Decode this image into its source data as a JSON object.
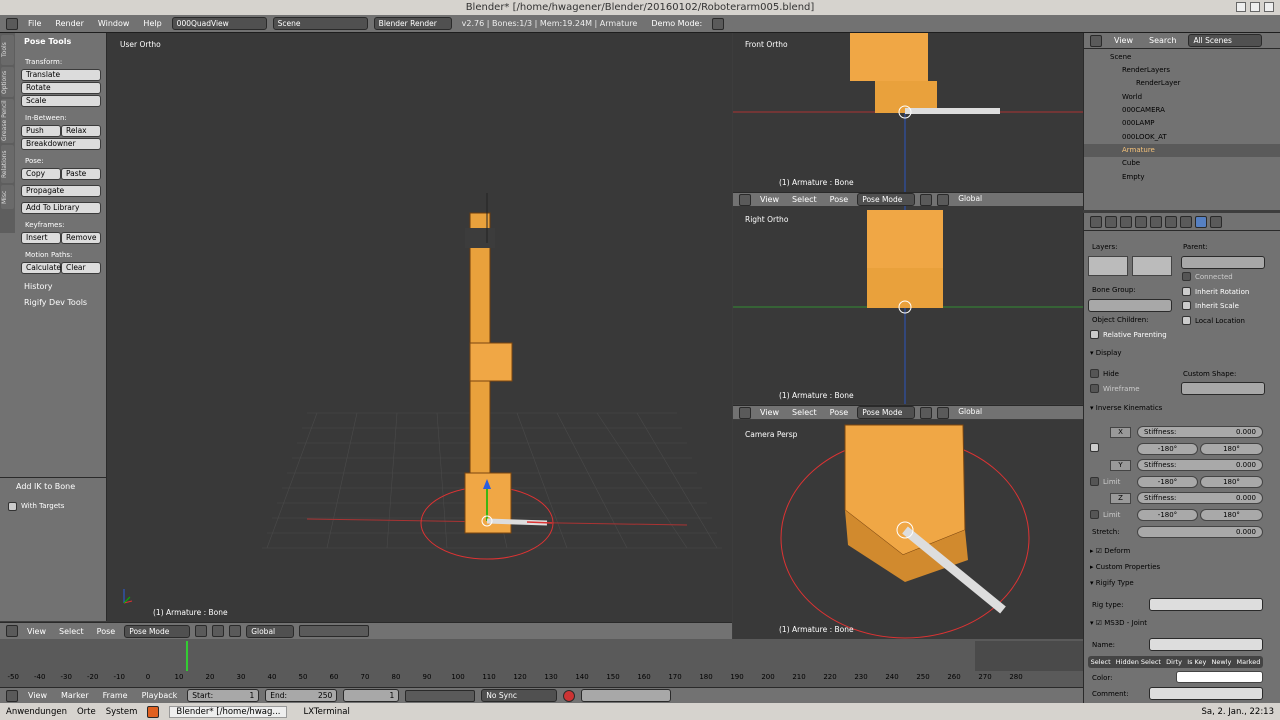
{
  "window": {
    "title": "Blender* [/home/hwagener/Blender/20160102/Roboterarm005.blend]"
  },
  "menubar": {
    "file": "File",
    "render": "Render",
    "window": "Window",
    "help": "Help",
    "screen_layout": "000QuadView",
    "scene": "Scene",
    "engine": "Blender Render",
    "stats": "v2.76 | Bones:1/3 | Mem:19.24M | Armature",
    "demo_mode": "Demo Mode:"
  },
  "toolshelf": {
    "tabs": [
      "Tools",
      "Options",
      "Grease Pencil",
      "Relations",
      "Misc"
    ],
    "pose_tools": "Pose Tools",
    "transform_label": "Transform:",
    "translate": "Translate",
    "rotate": "Rotate",
    "scale": "Scale",
    "in_between_label": "In-Between:",
    "push": "Push",
    "relax": "Relax",
    "breakdowner": "Breakdowner",
    "pose_label": "Pose:",
    "copy": "Copy",
    "paste": "Paste",
    "propagate": "Propagate",
    "add_to_library": "Add To Library",
    "keyframes_label": "Keyframes:",
    "insert": "Insert",
    "remove": "Remove",
    "motion_paths_label": "Motion Paths:",
    "calculate": "Calculate",
    "clear": "Clear",
    "history": "History",
    "rigify_dev": "Rigify Dev Tools",
    "operator_title": "Add IK to Bone",
    "with_targets": "With Targets"
  },
  "viewports": {
    "main": {
      "label": "User Ortho",
      "status": "(1) Armature : Bone"
    },
    "front": {
      "label": "Front Ortho",
      "status": "(1) Armature : Bone"
    },
    "right": {
      "label": "Right Ortho",
      "status": "(1) Armature : Bone"
    },
    "camera": {
      "label": "Camera Persp",
      "status": "(1) Armature : Bone"
    },
    "header": {
      "view": "View",
      "select": "Select",
      "pose": "Pose",
      "mode": "Pose Mode",
      "orientation": "Global"
    }
  },
  "outliner": {
    "view": "View",
    "search": "Search",
    "filter": "All Scenes",
    "items": [
      "Scene",
      "RenderLayers",
      "RenderLayer",
      "World",
      "000CAMERA",
      "000LAMP",
      "000LOOK_AT",
      "Armature",
      "Cube",
      "Empty"
    ]
  },
  "properties": {
    "layers": "Layers:",
    "parent": "Parent:",
    "connected": "Connected",
    "inherit_rotation": "Inherit Rotation",
    "bone_group": "Bone Group:",
    "inherit_scale": "Inherit Scale",
    "object_children": "Object Children:",
    "local_location": "Local Location",
    "relative_parenting": "Relative Parenting",
    "display": "Display",
    "hide": "Hide",
    "custom_shape": "Custom Shape:",
    "wireframe": "Wireframe",
    "ik": "Inverse Kinematics",
    "x": "X",
    "y": "Y",
    "z": "Z",
    "stiffness": "Stiffness:",
    "zero": "0.000",
    "limit": "Limit",
    "minus180": "-180°",
    "plus180": "180°",
    "stretch": "Stretch:",
    "deform": "Deform",
    "custom_properties": "Custom Properties",
    "rigify_type": "Rigify Type",
    "rig_type": "Rig type:",
    "ms3d_joint": "MS3D - Joint",
    "name": "Name:",
    "select_tabs": [
      "Select",
      "Hidden Select",
      "Dirty",
      "Is Key",
      "Newly",
      "Marked"
    ],
    "color": "Color:",
    "comment": "Comment:"
  },
  "timeline": {
    "ticks": [
      "-50",
      "-40",
      "-30",
      "-20",
      "-10",
      "0",
      "10",
      "20",
      "30",
      "40",
      "50",
      "60",
      "70",
      "80",
      "90",
      "100",
      "110",
      "120",
      "130",
      "140",
      "150",
      "160",
      "170",
      "180",
      "190",
      "200",
      "210",
      "220",
      "230",
      "240",
      "250",
      "260",
      "270",
      "280"
    ],
    "view": "View",
    "marker": "Marker",
    "frame": "Frame",
    "playback": "Playback",
    "start_label": "Start:",
    "start": "1",
    "end_label": "End:",
    "end": "250",
    "current": "1",
    "sync": "No Sync"
  },
  "taskbar": {
    "apps": "Anwendungen",
    "places": "Orte",
    "system": "System",
    "blender": "Blender* [/home/hwag...",
    "terminal": "LXTerminal",
    "clock": "Sa, 2. Jan., 22:13"
  }
}
